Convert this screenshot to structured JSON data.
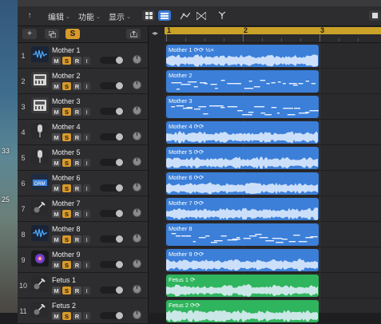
{
  "desktop": {
    "labels": [
      "33",
      "25"
    ]
  },
  "toolbar": {
    "menus": [
      {
        "label": "编辑"
      },
      {
        "label": "功能"
      },
      {
        "label": "显示"
      }
    ]
  },
  "subbar": {
    "add": "+",
    "solo_label": "S"
  },
  "ruler": {
    "bars": [
      "1",
      "2",
      "3"
    ]
  },
  "colors": {
    "audio_region": "#3b7fd9",
    "green_region": "#2fb55d",
    "solo": "#d89a2b",
    "cycle": "#c9a227"
  },
  "tracks": [
    {
      "num": "1",
      "name": "Mother 1",
      "icon": "waveform-icon",
      "region": "Mother 1 ⟳⟳ ½×",
      "type": "audio",
      "color": "blue"
    },
    {
      "num": "2",
      "name": "Mother 2",
      "icon": "keyboard-icon",
      "region": "Mother 2",
      "type": "midi",
      "color": "blue"
    },
    {
      "num": "3",
      "name": "Mother 3",
      "icon": "keyboard-icon",
      "region": "Mother 3",
      "type": "midi",
      "color": "blue"
    },
    {
      "num": "4",
      "name": "Mother 4",
      "icon": "microphone-icon",
      "region": "Mother 4 ⟳⟳",
      "type": "audio",
      "color": "blue"
    },
    {
      "num": "5",
      "name": "Mother 5",
      "icon": "microphone-icon",
      "region": "Mother 5 ⟳⟳",
      "type": "audio",
      "color": "blue"
    },
    {
      "num": "6",
      "name": "Mother 6",
      "icon": "drummer-icon",
      "region": "Mother 6 ⟳⟳",
      "type": "audio",
      "color": "blue"
    },
    {
      "num": "7",
      "name": "Mother 7",
      "icon": "guitar-icon",
      "region": "Mother 7 ⟳⟳",
      "type": "audio",
      "color": "blue"
    },
    {
      "num": "8",
      "name": "Mother 8",
      "icon": "waveform-icon",
      "region": "Mother 8",
      "type": "midi",
      "color": "blue"
    },
    {
      "num": "9",
      "name": "Mother 9",
      "icon": "synth-icon",
      "region": "Mother 9 ⟳⟳",
      "type": "audio",
      "color": "blue"
    },
    {
      "num": "10",
      "name": "Fetus 1",
      "icon": "guitar-icon",
      "region": "Fetus 1 ⟳",
      "type": "audio",
      "color": "green"
    },
    {
      "num": "11",
      "name": "Fetus 2",
      "icon": "guitar-icon",
      "region": "Fetus 2 ⟳⟳",
      "type": "audio",
      "color": "green"
    }
  ],
  "track_buttons": {
    "mute": "M",
    "solo": "S",
    "record": "R",
    "input": "I"
  }
}
